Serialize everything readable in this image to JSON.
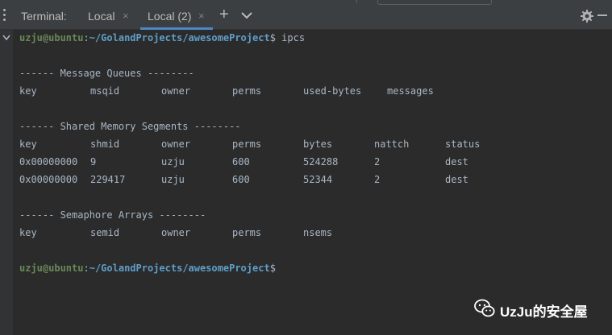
{
  "tabbar": {
    "title": "Terminal:",
    "tabs": [
      {
        "label": "Local",
        "close": "×"
      },
      {
        "label": "Local (2)",
        "close": "×"
      }
    ],
    "add_label": "+",
    "colors": {
      "active_underline": "#4a88c7",
      "background": "#3c3f41"
    }
  },
  "prompt": {
    "user": "uzju@ubuntu",
    "colon": ":",
    "path": "~/GolandProjects/awesomeProject",
    "symbol": "$",
    "command": "ipcs"
  },
  "msgq": {
    "heading": "------ Message Queues --------",
    "headers": [
      "key",
      "msqid",
      "owner",
      "perms",
      "used-bytes",
      "messages"
    ]
  },
  "shm": {
    "heading": "------ Shared Memory Segments --------",
    "headers": [
      "key",
      "shmid",
      "owner",
      "perms",
      "bytes",
      "nattch",
      "status"
    ],
    "rows": [
      [
        "0x00000000",
        "9",
        "uzju",
        "600",
        "524288",
        "2",
        "dest"
      ],
      [
        "0x00000000",
        "229417",
        "uzju",
        "600",
        "52344",
        "2",
        "dest"
      ]
    ]
  },
  "sem": {
    "heading": "------ Semaphore Arrays --------",
    "headers": [
      "key",
      "semid",
      "owner",
      "perms",
      "nsems"
    ]
  },
  "watermark": {
    "text": "UzJu的安全屋",
    "icon": "wechat-icon"
  },
  "colors": {
    "background": "#2b2b2b",
    "text": "#a9b7c6",
    "user": "#6a8759",
    "path": "#5f9ec8"
  }
}
